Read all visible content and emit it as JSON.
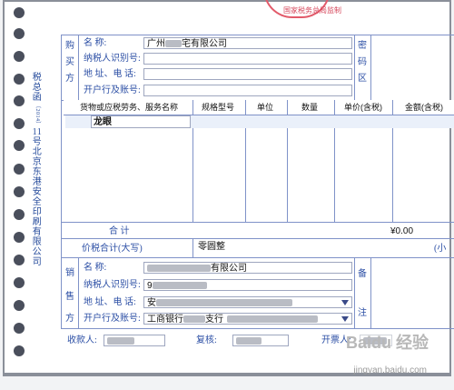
{
  "seal_text": "国家税务总局监制",
  "vertical_print": [
    "税",
    "总",
    "函",
    "〔2014〕",
    "11",
    "号",
    "北",
    "京",
    "东",
    "港",
    "安",
    "全",
    "印",
    "刷",
    "有",
    "限",
    "公",
    "司"
  ],
  "buyer": {
    "section_label": [
      "购",
      "买",
      "方"
    ],
    "name_label": "名      称:",
    "name_value": "广州****宅有限公司",
    "name_visible_prefix": "广州",
    "name_visible_suffix": "宅有限公司",
    "taxid_label": "纳税人识别号:",
    "address_label": "地 址、电 话:",
    "bank_label": "开户行及账号:"
  },
  "password_area": [
    "密",
    "码",
    "区"
  ],
  "table": {
    "headers": [
      "货物或应税劳务、服务名称",
      "规格型号",
      "单位",
      "数量",
      "单价(含税)",
      "金额(含税)"
    ],
    "rows": [
      {
        "name": "龙眼",
        "spec": "",
        "unit": "",
        "qty": "",
        "price": "",
        "amount": ""
      }
    ]
  },
  "totals": {
    "label": "合        计",
    "amount": "¥0.00",
    "tax_total_label": "价税合计(大写)",
    "tax_total_value": "零圆整",
    "lowercase_hint": "(小"
  },
  "seller": {
    "section_label": [
      "销",
      "售",
      "方"
    ],
    "name_label": "名      称:",
    "name_suffix": "有限公司",
    "taxid_label": "纳税人识别号:",
    "taxid_prefix": "9",
    "address_label": "地 址、电 话:",
    "address_prefix": "安",
    "bank_label": "开户行及账号:",
    "bank_prefix": "工商银行",
    "bank_middle": "支行",
    "remarks": [
      "备",
      "注"
    ]
  },
  "signatures": {
    "payee_label": "收款人:",
    "reviewer_label": "复核:",
    "issuer_label": "开票人:"
  },
  "watermark": {
    "brand": "Baidu 经验",
    "url": "jingyan.baidu.com"
  },
  "colors": {
    "label_blue": "#2c4fa5",
    "line_blue": "#7f92c8",
    "stamp_red": "#e25a6a"
  }
}
